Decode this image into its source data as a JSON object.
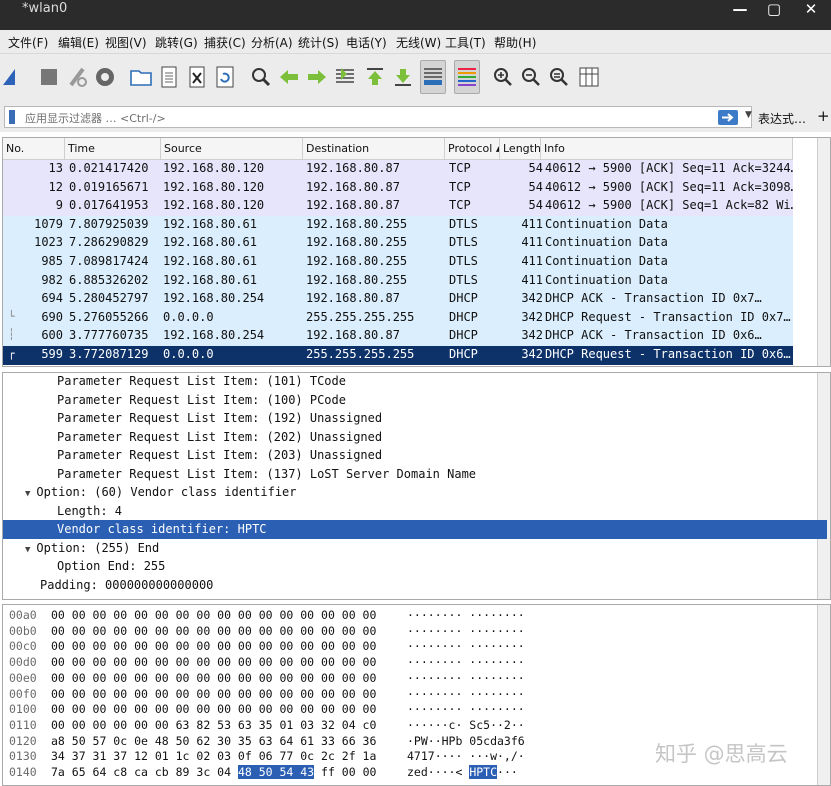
{
  "window": {
    "title": "*wlan0",
    "controls": {
      "minimize": "—",
      "maximize": "▢",
      "close": "✕"
    }
  },
  "menu": [
    "文件(F)",
    "编辑(E)",
    "视图(V)",
    "跳转(G)",
    "捕获(C)",
    "分析(A)",
    "统计(S)",
    "电话(Y)",
    "无线(W)",
    "工具(T)",
    "帮助(H)"
  ],
  "toolbar": [
    "shark-fin-icon",
    "stop-icon",
    "restart-icon",
    "options-gear-icon",
    "open-folder-icon",
    "save-file-icon",
    "close-file-icon",
    "reload-icon",
    "find-icon",
    "go-back-icon",
    "go-forward-icon",
    "go-to-packet-icon",
    "first-packet-icon",
    "last-packet-icon",
    "autoscroll-icon",
    "colorize-icon",
    "zoom-in-icon",
    "zoom-out-icon",
    "normal-size-icon",
    "resize-columns-icon"
  ],
  "filter": {
    "placeholder": "应用显示过滤器 … <Ctrl-/>",
    "expression_label": "表达式…",
    "add_label": "+"
  },
  "packet_list": {
    "columns": {
      "no": "No.",
      "time": "Time",
      "source": "Source",
      "destination": "Destination",
      "protocol": "Protocol ▴",
      "length": "Length",
      "info": "Info"
    },
    "rows": [
      {
        "no": "13",
        "time": "0.021417420",
        "src": "192.168.80.120",
        "dst": "192.168.80.87",
        "proto": "TCP",
        "len": "54",
        "info": "40612 → 5900 [ACK] Seq=11 Ack=3244…",
        "kind": "tcp",
        "rel": ""
      },
      {
        "no": "12",
        "time": "0.019165671",
        "src": "192.168.80.120",
        "dst": "192.168.80.87",
        "proto": "TCP",
        "len": "54",
        "info": "40612 → 5900 [ACK] Seq=11 Ack=3098…",
        "kind": "tcp",
        "rel": ""
      },
      {
        "no": "9",
        "time": "0.017641953",
        "src": "192.168.80.120",
        "dst": "192.168.80.87",
        "proto": "TCP",
        "len": "54",
        "info": "40612 → 5900 [ACK] Seq=1 Ack=82 Wi…",
        "kind": "tcp",
        "rel": ""
      },
      {
        "no": "1079",
        "time": "7.807925039",
        "src": "192.168.80.61",
        "dst": "192.168.80.255",
        "proto": "DTLS",
        "len": "411",
        "info": "Continuation Data",
        "kind": "udp",
        "rel": ""
      },
      {
        "no": "1023",
        "time": "7.286290829",
        "src": "192.168.80.61",
        "dst": "192.168.80.255",
        "proto": "DTLS",
        "len": "411",
        "info": "Continuation Data",
        "kind": "udp",
        "rel": ""
      },
      {
        "no": "985",
        "time": "7.089817424",
        "src": "192.168.80.61",
        "dst": "192.168.80.255",
        "proto": "DTLS",
        "len": "411",
        "info": "Continuation Data",
        "kind": "udp",
        "rel": ""
      },
      {
        "no": "982",
        "time": "6.885326202",
        "src": "192.168.80.61",
        "dst": "192.168.80.255",
        "proto": "DTLS",
        "len": "411",
        "info": "Continuation Data",
        "kind": "udp",
        "rel": ""
      },
      {
        "no": "694",
        "time": "5.280452797",
        "src": "192.168.80.254",
        "dst": "192.168.80.87",
        "proto": "DHCP",
        "len": "342",
        "info": "DHCP ACK       - Transaction ID 0x7…",
        "kind": "udp",
        "rel": ""
      },
      {
        "no": "690",
        "time": "5.276055266",
        "src": "0.0.0.0",
        "dst": "255.255.255.255",
        "proto": "DHCP",
        "len": "342",
        "info": "DHCP Request   - Transaction ID 0x7…",
        "kind": "udp",
        "rel": "└"
      },
      {
        "no": "600",
        "time": "3.777760735",
        "src": "192.168.80.254",
        "dst": "192.168.80.87",
        "proto": "DHCP",
        "len": "342",
        "info": "DHCP ACK       - Transaction ID 0x6…",
        "kind": "udp",
        "rel": "┆"
      },
      {
        "no": "599",
        "time": "3.772087129",
        "src": "0.0.0.0",
        "dst": "255.255.255.255",
        "proto": "DHCP",
        "len": "342",
        "info": "DHCP Request   - Transaction ID 0x6…",
        "kind": "sel",
        "rel": "┌"
      }
    ]
  },
  "details": [
    {
      "text": "Parameter Request List Item: (101) TCode",
      "indent": 3,
      "tw": "",
      "sel": false
    },
    {
      "text": "Parameter Request List Item: (100) PCode",
      "indent": 3,
      "tw": "",
      "sel": false
    },
    {
      "text": "Parameter Request List Item: (192) Unassigned",
      "indent": 3,
      "tw": "",
      "sel": false
    },
    {
      "text": "Parameter Request List Item: (202) Unassigned",
      "indent": 3,
      "tw": "",
      "sel": false
    },
    {
      "text": "Parameter Request List Item: (203) Unassigned",
      "indent": 3,
      "tw": "",
      "sel": false
    },
    {
      "text": "Parameter Request List Item: (137) LoST Server Domain Name",
      "indent": 3,
      "tw": "",
      "sel": false
    },
    {
      "text": "Option: (60) Vendor class identifier",
      "indent": 1,
      "tw": "▼",
      "sel": false
    },
    {
      "text": "Length: 4",
      "indent": 3,
      "tw": "",
      "sel": false
    },
    {
      "text": "Vendor class identifier: HPTC",
      "indent": 3,
      "tw": "",
      "sel": true
    },
    {
      "text": "Option: (255) End",
      "indent": 1,
      "tw": "▼",
      "sel": false
    },
    {
      "text": "Option End: 255",
      "indent": 2,
      "tw": "",
      "sel": false
    },
    {
      "text": "Padding: 000000000000000",
      "indent": 1,
      "tw": "",
      "sel": false
    }
  ],
  "bytes": [
    {
      "off": "00a0",
      "hex": "00 00 00 00 00 00 00 00  00 00 00 00 00 00 00 00",
      "hl": "",
      "post": "",
      "asc": "········ ········",
      "ahl": "",
      "apost": ""
    },
    {
      "off": "00b0",
      "hex": "00 00 00 00 00 00 00 00  00 00 00 00 00 00 00 00",
      "hl": "",
      "post": "",
      "asc": "········ ········",
      "ahl": "",
      "apost": ""
    },
    {
      "off": "00c0",
      "hex": "00 00 00 00 00 00 00 00  00 00 00 00 00 00 00 00",
      "hl": "",
      "post": "",
      "asc": "········ ········",
      "ahl": "",
      "apost": ""
    },
    {
      "off": "00d0",
      "hex": "00 00 00 00 00 00 00 00  00 00 00 00 00 00 00 00",
      "hl": "",
      "post": "",
      "asc": "········ ········",
      "ahl": "",
      "apost": ""
    },
    {
      "off": "00e0",
      "hex": "00 00 00 00 00 00 00 00  00 00 00 00 00 00 00 00",
      "hl": "",
      "post": "",
      "asc": "········ ········",
      "ahl": "",
      "apost": ""
    },
    {
      "off": "00f0",
      "hex": "00 00 00 00 00 00 00 00  00 00 00 00 00 00 00 00",
      "hl": "",
      "post": "",
      "asc": "········ ········",
      "ahl": "",
      "apost": ""
    },
    {
      "off": "0100",
      "hex": "00 00 00 00 00 00 00 00  00 00 00 00 00 00 00 00",
      "hl": "",
      "post": "",
      "asc": "········ ········",
      "ahl": "",
      "apost": ""
    },
    {
      "off": "0110",
      "hex": "00 00 00 00 00 00 63 82  53 63 35 01 03 32 04 c0",
      "hl": "",
      "post": "",
      "asc": "······c· Sc5··2··",
      "ahl": "",
      "apost": ""
    },
    {
      "off": "0120",
      "hex": "a8 50 57 0c 0e 48 50 62  30 35 63 64 61 33 66 36",
      "hl": "",
      "post": "",
      "asc": "·PW··HPb 05cda3f6",
      "ahl": "",
      "apost": ""
    },
    {
      "off": "0130",
      "hex": "34 37 31 37 12 01 1c 02  03 0f 06 77 0c 2c 2f 1a",
      "hl": "",
      "post": "",
      "asc": "4717···· ···w·,/·",
      "ahl": "",
      "apost": ""
    },
    {
      "off": "0140",
      "hex": "7a 65 64 c8 ca cb 89 3c  04 ",
      "hl": "48 50 54 43",
      "post": " ff 00 00",
      "asc": "zed····< ",
      "ahl": "HPTC",
      "apost": "···"
    }
  ],
  "watermark": "知乎 @思高云"
}
